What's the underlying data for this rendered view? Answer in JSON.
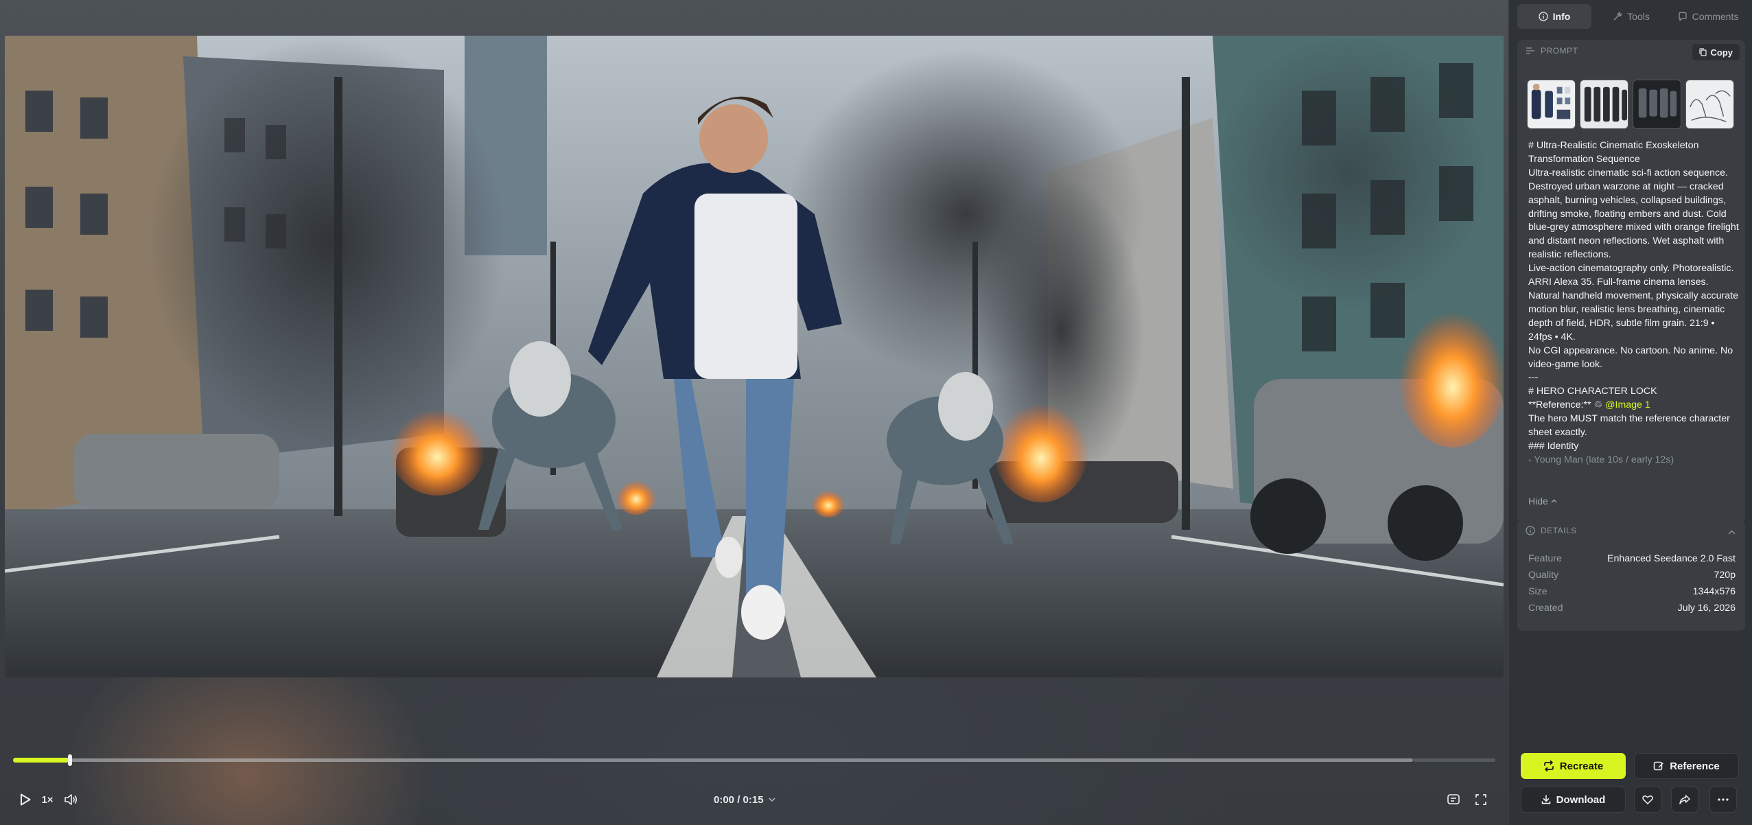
{
  "player": {
    "speed": "1×",
    "time": "0:00 / 0:15",
    "progress_fraction": 0.024,
    "icons": {
      "play": "play-icon",
      "volume": "volume-icon",
      "time_caret": "chevron-down-icon",
      "captions": "captions-icon",
      "fullscreen": "fullscreen-icon"
    }
  },
  "tabs": [
    {
      "label": "Info",
      "icon": "info-icon",
      "active": true
    },
    {
      "label": "Tools",
      "icon": "tools-icon",
      "active": false
    },
    {
      "label": "Comments",
      "icon": "comment-icon",
      "active": false
    }
  ],
  "prompt": {
    "header": "PROMPT",
    "copy_label": "Copy",
    "hide_label": "Hide",
    "lines": [
      "# Ultra-Realistic Cinematic Exoskeleton Transformation Sequence",
      "Ultra-realistic cinematic sci-fi action sequence. Destroyed urban warzone at night — cracked asphalt, burning vehicles, collapsed buildings, drifting smoke, floating embers and dust. Cold blue-grey atmosphere mixed with orange firelight and distant neon reflections. Wet asphalt with realistic reflections.",
      "Live-action cinematography only. Photorealistic. ARRI Alexa 35. Full-frame cinema lenses. Natural handheld movement, physically accurate motion blur, realistic lens breathing, cinematic depth of field, HDR, subtle film grain. 21:9 • 24fps • 4K.",
      "No CGI appearance. No cartoon. No anime. No video-game look.",
      "---",
      "# HERO CHARACTER LOCK"
    ],
    "reference_prefix": "**Reference:** ",
    "reference_mention": "@Image 1",
    "lines_after": [
      "The hero MUST match the reference character sheet exactly.",
      "### Identity"
    ],
    "faded_line": "- Young Man (late 10s / early 12s)"
  },
  "details": {
    "header": "DETAILS",
    "rows": [
      {
        "key": "Feature",
        "value": "Enhanced Seedance 2.0 Fast"
      },
      {
        "key": "Quality",
        "value": "720p"
      },
      {
        "key": "Size",
        "value": "1344x576"
      },
      {
        "key": "Created",
        "value": "July 16, 2026"
      }
    ]
  },
  "actions": {
    "recreate": "Recreate",
    "reference": "Reference",
    "download": "Download"
  },
  "colors": {
    "accent": "#d8f522",
    "panel": "#2f3236",
    "card": "#3a3e43"
  }
}
